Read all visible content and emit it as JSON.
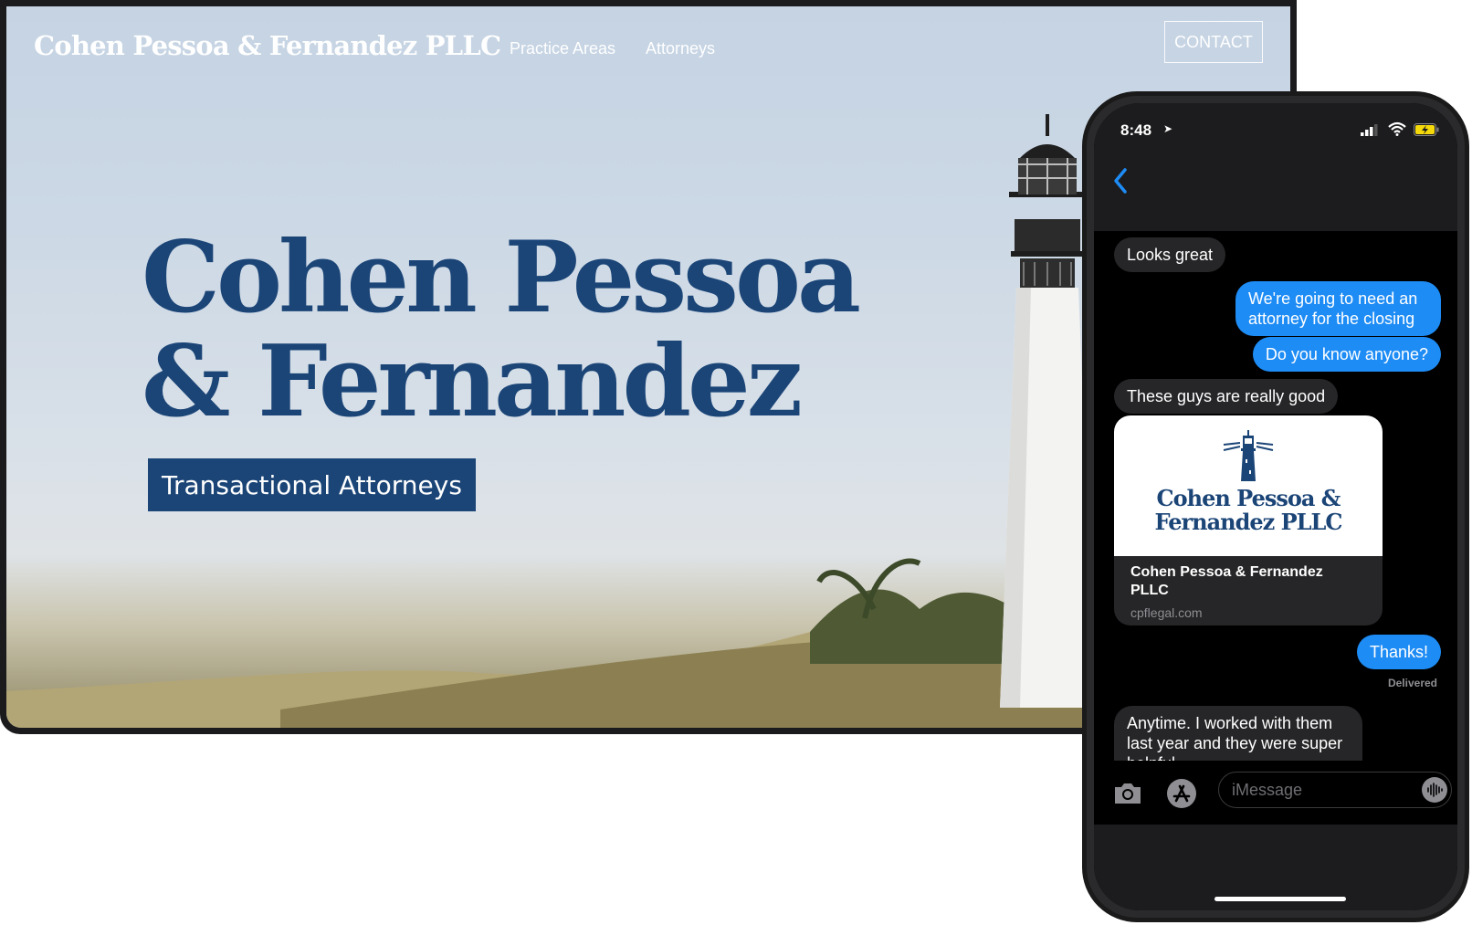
{
  "website": {
    "logo": "Cohen Pessoa & Fernandez PLLC",
    "nav": [
      "Practice Areas",
      "Attorneys"
    ],
    "contact_label": "CONTACT",
    "hero_line1": "Cohen Pessoa",
    "hero_line2": "& Fernandez",
    "hero_badge": "Transactional Attorneys",
    "brand_color": "#1b4577"
  },
  "phone": {
    "time": "8:48",
    "messages": [
      {
        "dir": "in",
        "text": "Looks great"
      },
      {
        "dir": "out",
        "text": "We're going to need an attorney for the closing"
      },
      {
        "dir": "out",
        "text": "Do you know anyone?"
      },
      {
        "dir": "in",
        "text": "These guys are really good"
      },
      {
        "dir": "out",
        "text": "Thanks!"
      },
      {
        "dir": "in",
        "text": "Anytime. I worked with them last year and they were super helpful"
      }
    ],
    "link_card": {
      "logo_line1": "Cohen Pessoa &",
      "logo_line2": "Fernandez PLLC",
      "title": "Cohen Pessoa & Fernandez PLLC",
      "url": "cpflegal.com"
    },
    "delivered": "Delivered",
    "input_placeholder": "iMessage",
    "bubble_out_color": "#1e8cf5",
    "bubble_in_color": "#262628"
  }
}
